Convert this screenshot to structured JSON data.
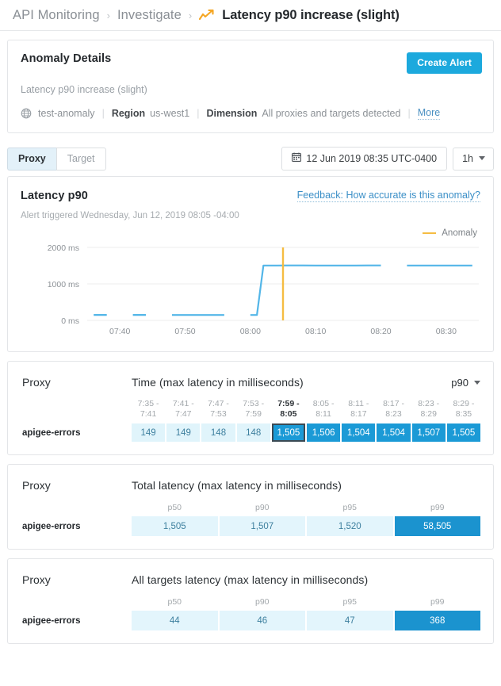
{
  "breadcrumb": {
    "item1": "API Monitoring",
    "item2": "Investigate",
    "separator": "›",
    "current": "Latency p90 increase (slight)",
    "icon": "trend-up-icon"
  },
  "anomaly_details": {
    "title": "Anomaly Details",
    "create_alert_label": "Create Alert",
    "description": "Latency p90 increase (slight)",
    "org_icon": "globe-icon",
    "org": "test-anomaly",
    "region_label": "Region",
    "region_value": "us-west1",
    "dimension_label": "Dimension",
    "dimension_value": "All proxies and targets detected",
    "more_label": "More",
    "separator": "|"
  },
  "toolbar": {
    "tabs": [
      {
        "label": "Proxy",
        "active": true
      },
      {
        "label": "Target",
        "active": false
      }
    ],
    "date_icon": "calendar-icon",
    "date_value": "12 Jun 2019 08:35 UTC-0400",
    "range_value": "1h",
    "range_icon": "chevron-down-icon"
  },
  "chart_card": {
    "title": "Latency p90",
    "feedback_link": "Feedback: How accurate is this anomaly?",
    "subtitle": "Alert triggered Wednesday, Jun 12, 2019 08:05 -04:00",
    "legend_label": "Anomaly",
    "legend_color": "#f5bc42"
  },
  "chart_data": {
    "type": "line",
    "title": "Latency p90",
    "xlabel": "",
    "ylabel": "",
    "ylim": [
      0,
      2000
    ],
    "ytick_labels": [
      "0 ms",
      "1000 ms",
      "2000 ms"
    ],
    "ytick_values": [
      0,
      1000,
      2000
    ],
    "xtick_labels": [
      "07:40",
      "07:50",
      "08:00",
      "08:10",
      "08:20",
      "08:30"
    ],
    "xlim": [
      "07:35",
      "08:35"
    ],
    "grid": true,
    "legend_position": "top-right",
    "line_color": "#53b6e8",
    "annotation": {
      "type": "vertical-line",
      "label": "Anomaly",
      "x": "08:05",
      "color": "#f5bc42"
    },
    "series": [
      {
        "name": "Latency p90",
        "x": [
          "07:36",
          "07:38",
          "07:40",
          "07:42",
          "07:44",
          "07:46",
          "07:48",
          "07:50",
          "07:52",
          "07:54",
          "07:56",
          "07:58",
          "08:00",
          "08:01",
          "08:02",
          "08:04",
          "08:06",
          "08:08",
          "08:10",
          "08:12",
          "08:14",
          "08:16",
          "08:18",
          "08:20",
          "08:22",
          "08:24",
          "08:26",
          "08:28",
          "08:30",
          "08:32",
          "08:34"
        ],
        "values": [
          149,
          149,
          null,
          149,
          149,
          null,
          148,
          148,
          148,
          148,
          148,
          null,
          148,
          148,
          1505,
          1505,
          1506,
          1506,
          1504,
          1504,
          1504,
          1504,
          1507,
          1507,
          null,
          1505,
          1505,
          1505,
          1505,
          1505,
          1505
        ]
      }
    ]
  },
  "time_table": {
    "proxy_label": "Proxy",
    "caption": "Time (max latency in milliseconds)",
    "percentile_selector": "p90",
    "percentile_icon": "chevron-down-icon",
    "columns": [
      {
        "top": "7:35 -",
        "bottom": "7:41",
        "selected": false
      },
      {
        "top": "7:41 -",
        "bottom": "7:47",
        "selected": false
      },
      {
        "top": "7:47 -",
        "bottom": "7:53",
        "selected": false
      },
      {
        "top": "7:53 -",
        "bottom": "7:59",
        "selected": false
      },
      {
        "top": "7:59 -",
        "bottom": "8:05",
        "selected": true
      },
      {
        "top": "8:05 -",
        "bottom": "8:11",
        "selected": false
      },
      {
        "top": "8:11 -",
        "bottom": "8:17",
        "selected": false
      },
      {
        "top": "8:17 -",
        "bottom": "8:23",
        "selected": false
      },
      {
        "top": "8:23 -",
        "bottom": "8:29",
        "selected": false
      },
      {
        "top": "8:29 -",
        "bottom": "8:35",
        "selected": false
      }
    ],
    "rows": [
      {
        "name": "apigee-errors",
        "cells": [
          {
            "value": "149",
            "level": "low",
            "selected": false
          },
          {
            "value": "149",
            "level": "low",
            "selected": false
          },
          {
            "value": "148",
            "level": "low",
            "selected": false
          },
          {
            "value": "148",
            "level": "low",
            "selected": false
          },
          {
            "value": "1,505",
            "level": "high",
            "selected": true
          },
          {
            "value": "1,506",
            "level": "high",
            "selected": false
          },
          {
            "value": "1,504",
            "level": "high",
            "selected": false
          },
          {
            "value": "1,504",
            "level": "high",
            "selected": false
          },
          {
            "value": "1,507",
            "level": "high",
            "selected": false
          },
          {
            "value": "1,505",
            "level": "high",
            "selected": false
          }
        ]
      }
    ]
  },
  "total_latency_table": {
    "proxy_label": "Proxy",
    "caption": "Total latency (max latency in milliseconds)",
    "columns": [
      "p50",
      "p90",
      "p95",
      "p99"
    ],
    "rows": [
      {
        "name": "apigee-errors",
        "cells": [
          {
            "value": "1,505",
            "level": "low"
          },
          {
            "value": "1,507",
            "level": "low"
          },
          {
            "value": "1,520",
            "level": "low"
          },
          {
            "value": "58,505",
            "level": "high"
          }
        ]
      }
    ]
  },
  "targets_latency_table": {
    "proxy_label": "Proxy",
    "caption": "All targets latency (max latency in milliseconds)",
    "columns": [
      "p50",
      "p90",
      "p95",
      "p99"
    ],
    "rows": [
      {
        "name": "apigee-errors",
        "cells": [
          {
            "value": "44",
            "level": "low"
          },
          {
            "value": "46",
            "level": "low"
          },
          {
            "value": "47",
            "level": "low"
          },
          {
            "value": "368",
            "level": "high"
          }
        ]
      }
    ]
  }
}
